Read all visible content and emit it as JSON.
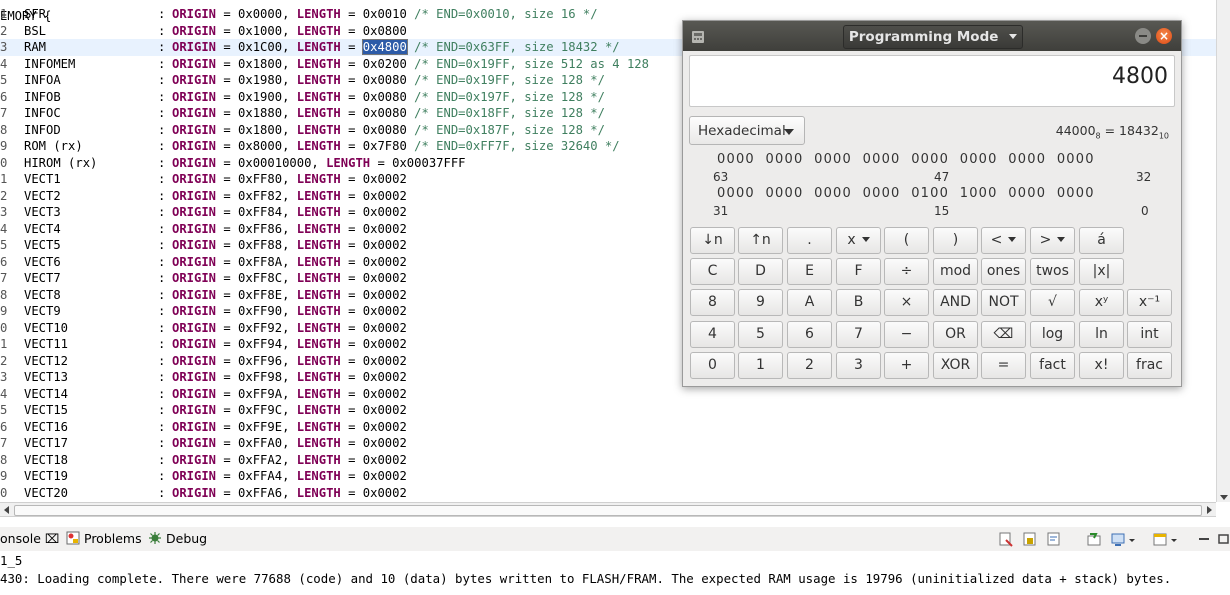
{
  "editor": {
    "cut_top_line": "EMORY {",
    "lines": [
      {
        "num": "1",
        "name": "SFR",
        "rest": [
          [
            "kw",
            "ORIGIN"
          ],
          [
            "t",
            " = 0x0000, "
          ],
          [
            "kw",
            "LENGTH"
          ],
          [
            "t",
            " = 0x0010 "
          ],
          [
            "cm",
            "/* END=0x0010, size 16 */"
          ]
        ]
      },
      {
        "num": "2",
        "name": "BSL",
        "rest": [
          [
            "kw",
            "ORIGIN"
          ],
          [
            "t",
            " = 0x1000, "
          ],
          [
            "kw",
            "LENGTH"
          ],
          [
            "t",
            " = 0x0800"
          ]
        ]
      },
      {
        "num": "3",
        "name": "RAM",
        "rest": [
          [
            "kw",
            "ORIGIN"
          ],
          [
            "t",
            " = 0x1C00, "
          ],
          [
            "kw",
            "LENGTH"
          ],
          [
            "t",
            " = "
          ],
          [
            "sel",
            "0x4800"
          ],
          [
            "t",
            " "
          ],
          [
            "cm",
            "/* END=0x63FF, size 18432 */"
          ]
        ]
      },
      {
        "num": "4",
        "name": "INFOMEM",
        "rest": [
          [
            "kw",
            "ORIGIN"
          ],
          [
            "t",
            " = 0x1800, "
          ],
          [
            "kw",
            "LENGTH"
          ],
          [
            "t",
            " = 0x0200 "
          ],
          [
            "cm",
            "/* END=0x19FF, size 512 as 4 128"
          ]
        ]
      },
      {
        "num": "5",
        "name": "INFOA",
        "rest": [
          [
            "kw",
            "ORIGIN"
          ],
          [
            "t",
            " = 0x1980, "
          ],
          [
            "kw",
            "LENGTH"
          ],
          [
            "t",
            " = 0x0080 "
          ],
          [
            "cm",
            "/* END=0x19FF, size 128 */"
          ]
        ]
      },
      {
        "num": "6",
        "name": "INFOB",
        "rest": [
          [
            "kw",
            "ORIGIN"
          ],
          [
            "t",
            " = 0x1900, "
          ],
          [
            "kw",
            "LENGTH"
          ],
          [
            "t",
            " = 0x0080 "
          ],
          [
            "cm",
            "/* END=0x197F, size 128 */"
          ]
        ]
      },
      {
        "num": "7",
        "name": "INFOC",
        "rest": [
          [
            "kw",
            "ORIGIN"
          ],
          [
            "t",
            " = 0x1880, "
          ],
          [
            "kw",
            "LENGTH"
          ],
          [
            "t",
            " = 0x0080 "
          ],
          [
            "cm",
            "/* END=0x18FF, size 128 */"
          ]
        ]
      },
      {
        "num": "8",
        "name": "INFOD",
        "rest": [
          [
            "kw",
            "ORIGIN"
          ],
          [
            "t",
            " = 0x1800, "
          ],
          [
            "kw",
            "LENGTH"
          ],
          [
            "t",
            " = 0x0080 "
          ],
          [
            "cm",
            "/* END=0x187F, size 128 */"
          ]
        ]
      },
      {
        "num": "9",
        "name": "ROM (rx)",
        "rest": [
          [
            "kw",
            "ORIGIN"
          ],
          [
            "t",
            " = 0x8000, "
          ],
          [
            "kw",
            "LENGTH"
          ],
          [
            "t",
            " = 0x7F80 "
          ],
          [
            "cm",
            "/* END=0xFF7F, size 32640 */"
          ]
        ]
      },
      {
        "num": "0",
        "name": "HIROM (rx)",
        "rest": [
          [
            "kw",
            "ORIGIN"
          ],
          [
            "t",
            " = 0x00010000, "
          ],
          [
            "kw",
            "LENGTH"
          ],
          [
            "t",
            " = 0x00037FFF"
          ]
        ]
      },
      {
        "num": "1",
        "name": "VECT1",
        "rest": [
          [
            "kw",
            "ORIGIN"
          ],
          [
            "t",
            " = 0xFF80, "
          ],
          [
            "kw",
            "LENGTH"
          ],
          [
            "t",
            " = 0x0002"
          ]
        ]
      },
      {
        "num": "2",
        "name": "VECT2",
        "rest": [
          [
            "kw",
            "ORIGIN"
          ],
          [
            "t",
            " = 0xFF82, "
          ],
          [
            "kw",
            "LENGTH"
          ],
          [
            "t",
            " = 0x0002"
          ]
        ]
      },
      {
        "num": "3",
        "name": "VECT3",
        "rest": [
          [
            "kw",
            "ORIGIN"
          ],
          [
            "t",
            " = 0xFF84, "
          ],
          [
            "kw",
            "LENGTH"
          ],
          [
            "t",
            " = 0x0002"
          ]
        ]
      },
      {
        "num": "4",
        "name": "VECT4",
        "rest": [
          [
            "kw",
            "ORIGIN"
          ],
          [
            "t",
            " = 0xFF86, "
          ],
          [
            "kw",
            "LENGTH"
          ],
          [
            "t",
            " = 0x0002"
          ]
        ]
      },
      {
        "num": "5",
        "name": "VECT5",
        "rest": [
          [
            "kw",
            "ORIGIN"
          ],
          [
            "t",
            " = 0xFF88, "
          ],
          [
            "kw",
            "LENGTH"
          ],
          [
            "t",
            " = 0x0002"
          ]
        ]
      },
      {
        "num": "6",
        "name": "VECT6",
        "rest": [
          [
            "kw",
            "ORIGIN"
          ],
          [
            "t",
            " = 0xFF8A, "
          ],
          [
            "kw",
            "LENGTH"
          ],
          [
            "t",
            " = 0x0002"
          ]
        ]
      },
      {
        "num": "7",
        "name": "VECT7",
        "rest": [
          [
            "kw",
            "ORIGIN"
          ],
          [
            "t",
            " = 0xFF8C, "
          ],
          [
            "kw",
            "LENGTH"
          ],
          [
            "t",
            " = 0x0002"
          ]
        ]
      },
      {
        "num": "8",
        "name": "VECT8",
        "rest": [
          [
            "kw",
            "ORIGIN"
          ],
          [
            "t",
            " = 0xFF8E, "
          ],
          [
            "kw",
            "LENGTH"
          ],
          [
            "t",
            " = 0x0002"
          ]
        ]
      },
      {
        "num": "9",
        "name": "VECT9",
        "rest": [
          [
            "kw",
            "ORIGIN"
          ],
          [
            "t",
            " = 0xFF90, "
          ],
          [
            "kw",
            "LENGTH"
          ],
          [
            "t",
            " = 0x0002"
          ]
        ]
      },
      {
        "num": "0",
        "name": "VECT10",
        "rest": [
          [
            "kw",
            "ORIGIN"
          ],
          [
            "t",
            " = 0xFF92, "
          ],
          [
            "kw",
            "LENGTH"
          ],
          [
            "t",
            " = 0x0002"
          ]
        ]
      },
      {
        "num": "1",
        "name": "VECT11",
        "rest": [
          [
            "kw",
            "ORIGIN"
          ],
          [
            "t",
            " = 0xFF94, "
          ],
          [
            "kw",
            "LENGTH"
          ],
          [
            "t",
            " = 0x0002"
          ]
        ]
      },
      {
        "num": "2",
        "name": "VECT12",
        "rest": [
          [
            "kw",
            "ORIGIN"
          ],
          [
            "t",
            " = 0xFF96, "
          ],
          [
            "kw",
            "LENGTH"
          ],
          [
            "t",
            " = 0x0002"
          ]
        ]
      },
      {
        "num": "3",
        "name": "VECT13",
        "rest": [
          [
            "kw",
            "ORIGIN"
          ],
          [
            "t",
            " = 0xFF98, "
          ],
          [
            "kw",
            "LENGTH"
          ],
          [
            "t",
            " = 0x0002"
          ]
        ]
      },
      {
        "num": "4",
        "name": "VECT14",
        "rest": [
          [
            "kw",
            "ORIGIN"
          ],
          [
            "t",
            " = 0xFF9A, "
          ],
          [
            "kw",
            "LENGTH"
          ],
          [
            "t",
            " = 0x0002"
          ]
        ]
      },
      {
        "num": "5",
        "name": "VECT15",
        "rest": [
          [
            "kw",
            "ORIGIN"
          ],
          [
            "t",
            " = 0xFF9C, "
          ],
          [
            "kw",
            "LENGTH"
          ],
          [
            "t",
            " = 0x0002"
          ]
        ]
      },
      {
        "num": "6",
        "name": "VECT16",
        "rest": [
          [
            "kw",
            "ORIGIN"
          ],
          [
            "t",
            " = 0xFF9E, "
          ],
          [
            "kw",
            "LENGTH"
          ],
          [
            "t",
            " = 0x0002"
          ]
        ]
      },
      {
        "num": "7",
        "name": "VECT17",
        "rest": [
          [
            "kw",
            "ORIGIN"
          ],
          [
            "t",
            " = 0xFFA0, "
          ],
          [
            "kw",
            "LENGTH"
          ],
          [
            "t",
            " = 0x0002"
          ]
        ]
      },
      {
        "num": "8",
        "name": "VECT18",
        "rest": [
          [
            "kw",
            "ORIGIN"
          ],
          [
            "t",
            " = 0xFFA2, "
          ],
          [
            "kw",
            "LENGTH"
          ],
          [
            "t",
            " = 0x0002"
          ]
        ]
      },
      {
        "num": "9",
        "name": "VECT19",
        "rest": [
          [
            "kw",
            "ORIGIN"
          ],
          [
            "t",
            " = 0xFFA4, "
          ],
          [
            "kw",
            "LENGTH"
          ],
          [
            "t",
            " = 0x0002"
          ]
        ]
      },
      {
        "num": "0",
        "name": "VECT20",
        "rest": [
          [
            "kw",
            "ORIGIN"
          ],
          [
            "t",
            " = 0xFFA6, "
          ],
          [
            "kw",
            "LENGTH"
          ],
          [
            "t",
            " = 0x0002"
          ]
        ]
      }
    ],
    "colon": ":"
  },
  "console": {
    "tabs": [
      {
        "label": "onsole ⌧",
        "icon": "console-icon"
      },
      {
        "label": "Problems",
        "icon": "problems-icon"
      },
      {
        "label": "Debug",
        "icon": "debug-icon"
      }
    ],
    "toolbar_icons": [
      "clear-console-icon",
      "scroll-lock-icon",
      "word-wrap-icon",
      "pin-console-icon",
      "display-selected-icon",
      "open-console-icon",
      "minimize-icon",
      "maximize-icon"
    ],
    "line1": "1_5",
    "line2": "430: Loading complete. There were 77688 (code) and 10 (data) bytes written to FLASH/FRAM. The expected RAM usage is 19796 (uninitialized data + stack) bytes."
  },
  "calculator": {
    "title": "Programming Mode",
    "display_value": "4800",
    "base": "Hexadecimal",
    "conversion_octal": "44000",
    "conversion_octal_sub": "8",
    "conversion_eq": " = ",
    "conversion_dec": "18432",
    "conversion_dec_sub": "10",
    "bits_row1": "0000  0000  0000  0000  0000  0000  0000  0000",
    "bits_row2": "0000  0000  0000  0000  0100  1000  0000  0000",
    "bit_labels": {
      "a": "63",
      "b": "47",
      "c": "32",
      "d": "31",
      "e": "15",
      "f": "0"
    },
    "keys": [
      [
        "↓n",
        "↑n",
        ".",
        "x",
        "(",
        ")",
        "<",
        ">",
        "á"
      ],
      [
        "C",
        "D",
        "E",
        "F",
        "÷",
        "mod",
        "ones",
        "twos",
        "|x|"
      ],
      [
        "8",
        "9",
        "A",
        "B",
        "×",
        "AND",
        "NOT",
        "√",
        "xʸ",
        "x⁻¹"
      ],
      [
        "4",
        "5",
        "6",
        "7",
        "−",
        "OR",
        "⌫",
        "log",
        "ln",
        "int"
      ],
      [
        "0",
        "1",
        "2",
        "3",
        "+",
        "XOR",
        "=",
        "fact",
        "x!",
        "frac"
      ]
    ]
  }
}
